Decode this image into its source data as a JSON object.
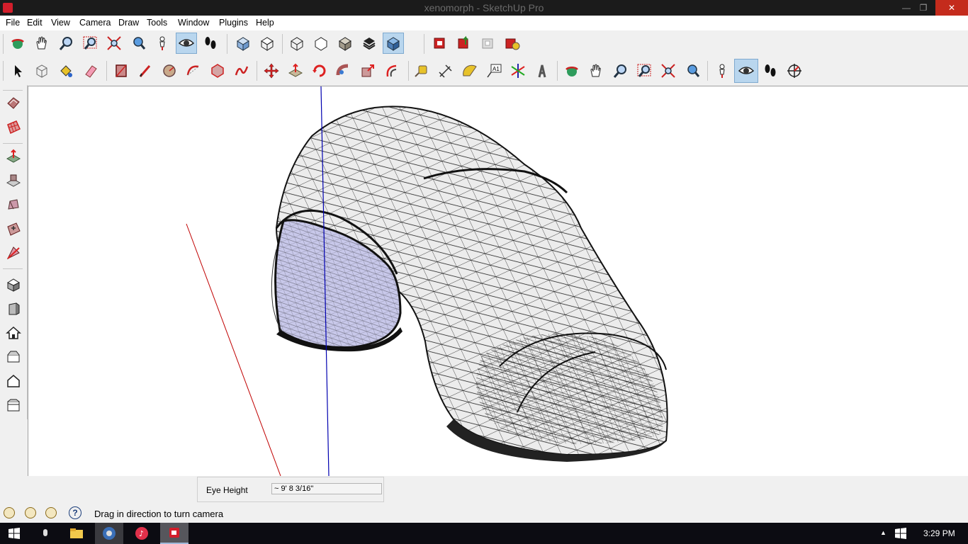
{
  "window": {
    "title": "xenomorph - SketchUp Pro",
    "controls": {
      "minimize": "—",
      "maximize": "❐",
      "close": "✕"
    }
  },
  "menu": [
    "File",
    "Edit",
    "View",
    "Camera",
    "Draw",
    "Tools",
    "Window",
    "Plugins",
    "Help"
  ],
  "toolbar_top": [
    "orbit-icon",
    "pan-icon",
    "zoom-icon",
    "zoom-window-icon",
    "zoom-extents-icon",
    "previous-view-icon",
    "position-camera-icon",
    "look-around-icon",
    "walk-icon",
    "iso-view-icon",
    "top-view-icon",
    "xray-icon",
    "wireframe-icon",
    "hidden-line-icon",
    "shaded-icon",
    "shaded-textures-icon",
    "3d-warehouse-icon",
    "share-model-icon",
    "get-models-icon",
    "extension-warehouse-icon"
  ],
  "toolbar_main": [
    "select-icon",
    "make-component-icon",
    "paint-bucket-icon",
    "eraser-icon",
    "rectangle-icon",
    "line-icon",
    "circle-icon",
    "arc-icon",
    "polygon-icon",
    "freehand-icon",
    "move-icon",
    "push-pull-icon",
    "rotate-icon",
    "follow-me-icon",
    "scale-icon",
    "offset-icon",
    "tape-measure-icon",
    "dimension-icon",
    "protractor-icon",
    "text-icon",
    "axes-icon",
    "3d-text-icon",
    "orbit-icon",
    "pan-icon",
    "zoom-icon",
    "zoom-window-icon",
    "zoom-extents-icon",
    "previous-view-icon",
    "position-camera-icon",
    "look-around-icon",
    "walk-icon",
    "section-plane-icon"
  ],
  "active_tool": "look-around-icon",
  "side_toolbar": [
    "sandbox-from-contours-icon",
    "sandbox-from-scratch-icon",
    "smoove-icon",
    "stamp-icon",
    "drape-icon",
    "add-detail-icon",
    "flip-edge-icon",
    "iso-view-icon",
    "front-view-icon",
    "home-view-icon",
    "back-view-icon",
    "left-view-icon",
    "right-view-icon"
  ],
  "measurements": {
    "label": "Eye Height",
    "value": "~ 9' 8 3/16\""
  },
  "status": {
    "message": "Drag in direction to turn camera",
    "help": "?"
  },
  "taskbar": {
    "apps": [
      "start-icon",
      "mouse-icon",
      "file-explorer-icon",
      "chrome-icon",
      "itunes-icon",
      "sketchup-icon"
    ],
    "time": "3:29 PM"
  },
  "colors": {
    "title_bar": "#1b1b1b",
    "close_button": "#c42b1c",
    "active_tool_bg": "#b9d6ee",
    "red_axis": "#c00000",
    "blue_axis": "#0000b0",
    "inner_face": "#c8c8ea"
  }
}
